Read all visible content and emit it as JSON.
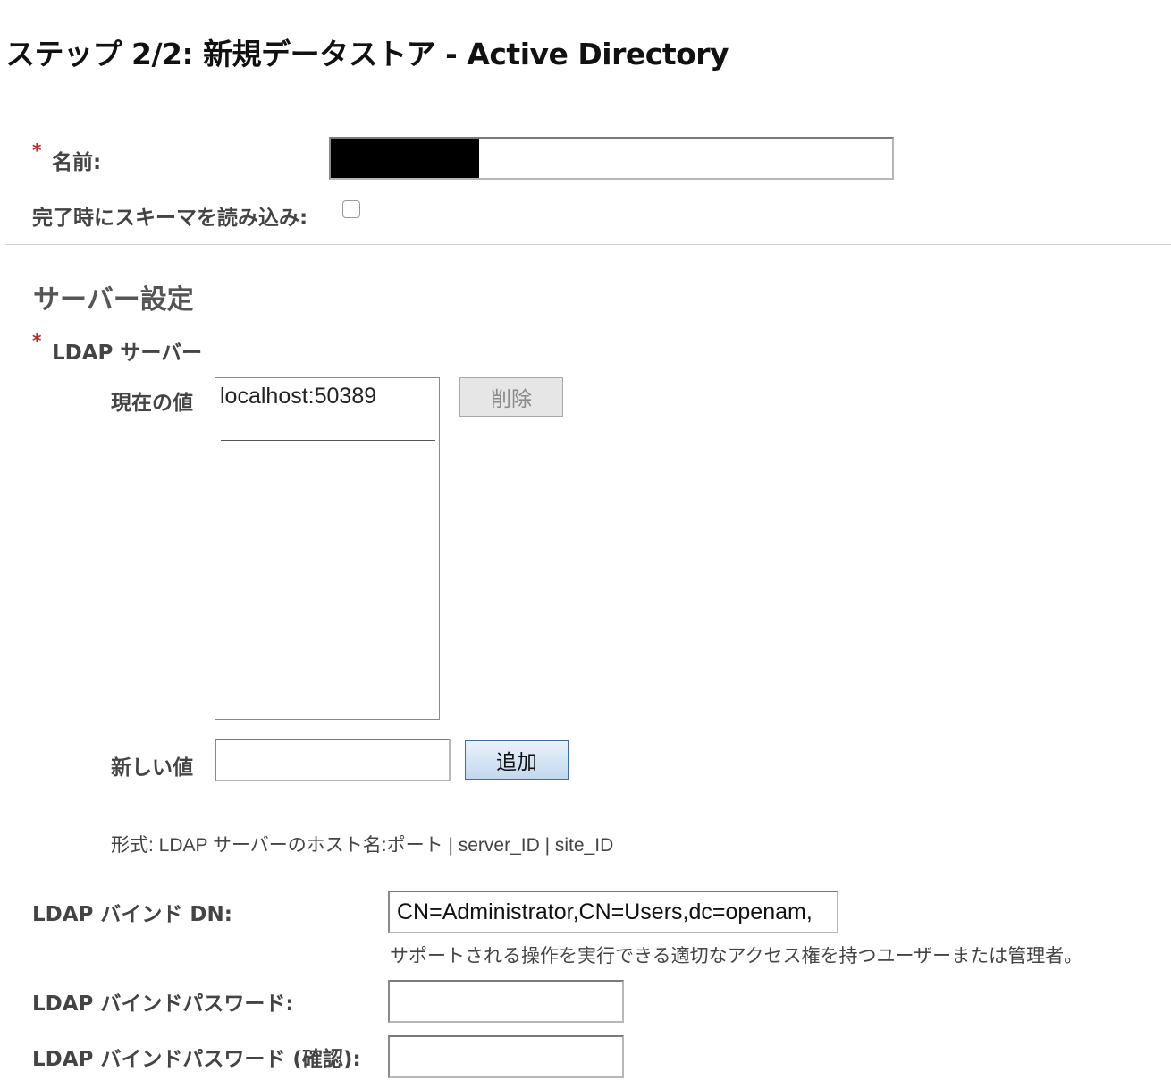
{
  "page": {
    "title": "ステップ 2/2: 新規データストア - Active Directory"
  },
  "name_field": {
    "required_mark": "*",
    "label": "名前:",
    "value": ""
  },
  "load_schema": {
    "label": "完了時にスキーマを読み込み:",
    "checked": false
  },
  "server_settings": {
    "heading": "サーバー設定",
    "ldap_server": {
      "required_mark": "*",
      "label": "LDAP サーバー",
      "current_label": "現在の値",
      "current_values": [
        "localhost:50389"
      ],
      "delete_button": "削除",
      "new_label": "新しい値",
      "new_value": "",
      "add_button": "追加",
      "format_hint": "形式: LDAP サーバーのホスト名:ポート | server_ID | site_ID"
    },
    "bind_dn": {
      "label": "LDAP バインド DN:",
      "value": "CN=Administrator,CN=Users,dc=openam,",
      "help": "サポートされる操作を実行できる適切なアクセス権を持つユーザーまたは管理者。"
    },
    "bind_password": {
      "label": "LDAP バインドパスワード:",
      "value": ""
    },
    "bind_password_confirm": {
      "label": "LDAP バインドパスワード (確認):",
      "value": ""
    }
  }
}
